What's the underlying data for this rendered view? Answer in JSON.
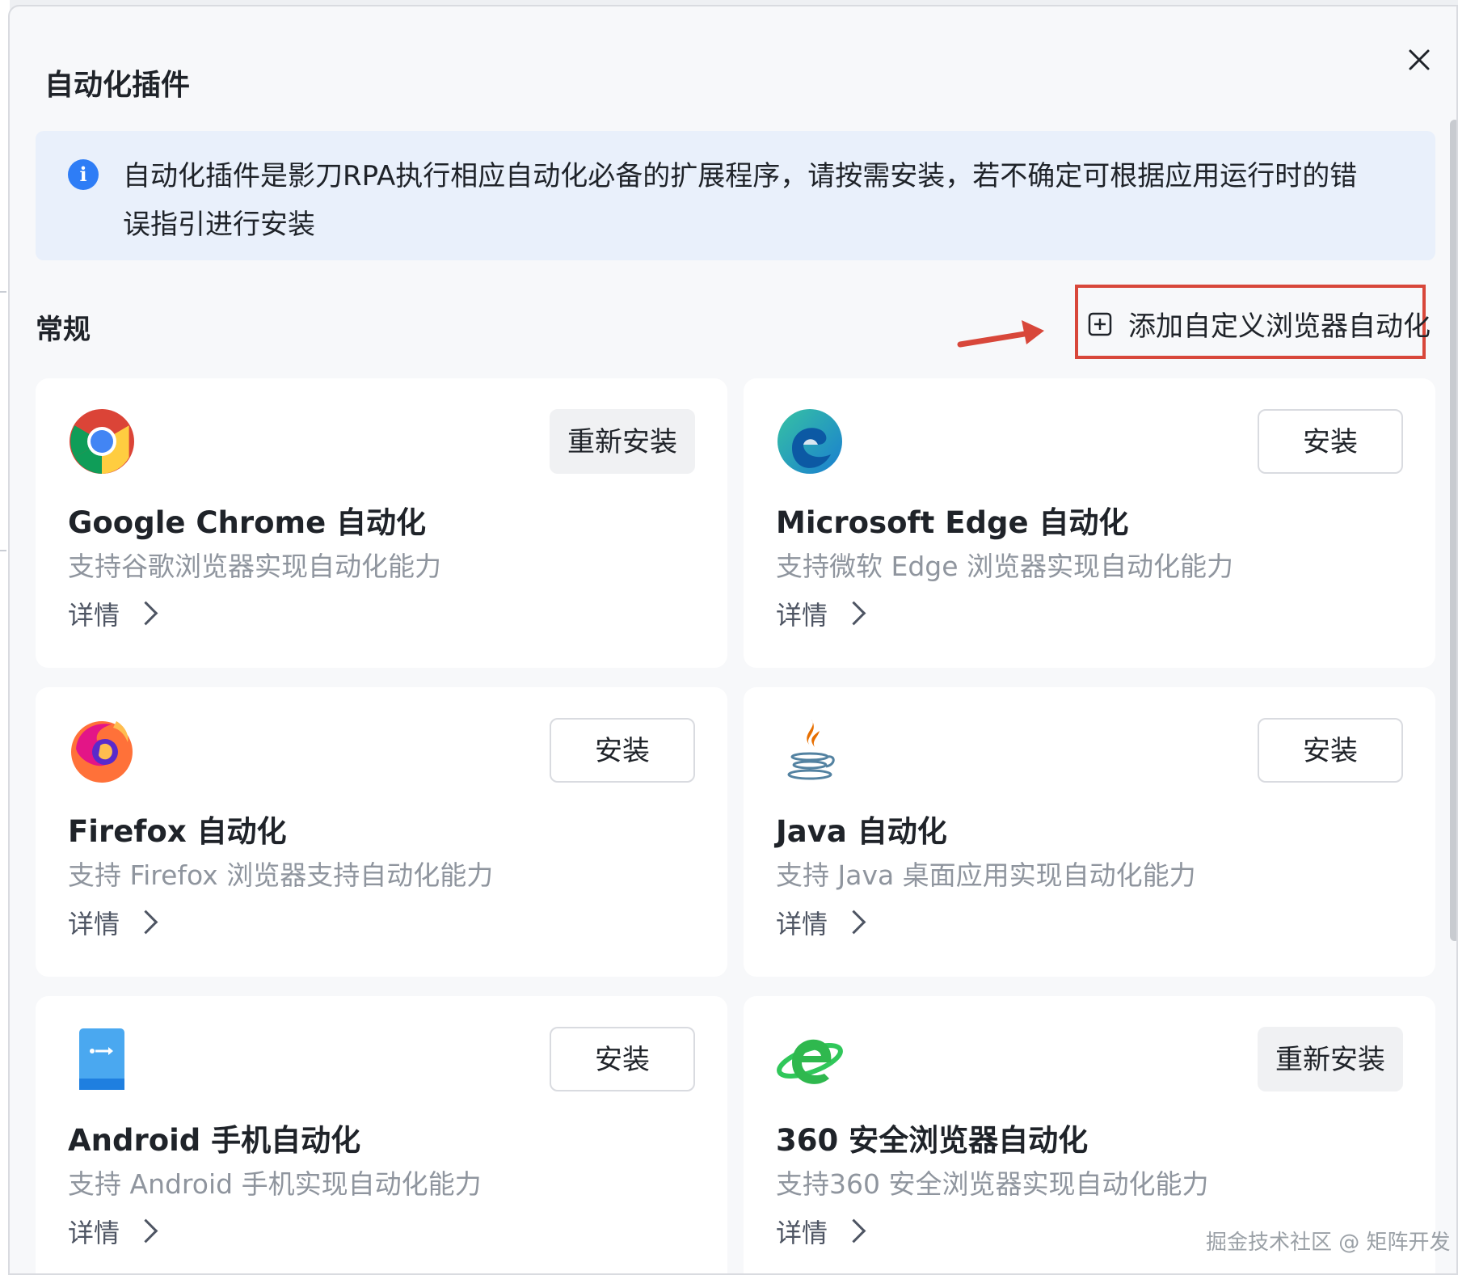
{
  "dialog": {
    "title": "自动化插件",
    "close_icon": "close-icon"
  },
  "notice": {
    "icon": "info-icon",
    "icon_glyph": "i",
    "text": "自动化插件是影刀RPA执行相应自动化必备的扩展程序，请按需安装，若不确定可根据应用运行时的错误指引进行安装"
  },
  "section": {
    "title": "常规",
    "add_button_label": "添加自定义浏览器自动化"
  },
  "plugins": [
    {
      "name": "Google Chrome 自动化",
      "desc": "支持谷歌浏览器实现自动化能力",
      "action": "重新安装",
      "details": "详情",
      "icon": "chrome-icon"
    },
    {
      "name": "Microsoft Edge 自动化",
      "desc": "支持微软 Edge 浏览器实现自动化能力",
      "action": "安装",
      "details": "详情",
      "icon": "edge-icon"
    },
    {
      "name": "Firefox 自动化",
      "desc": "支持 Firefox 浏览器支持自动化能力",
      "action": "安装",
      "details": "详情",
      "icon": "firefox-icon"
    },
    {
      "name": "Java 自动化",
      "desc": "支持 Java 桌面应用实现自动化能力",
      "action": "安装",
      "details": "详情",
      "icon": "java-icon"
    },
    {
      "name": "Android 手机自动化",
      "desc": "支持 Android 手机实现自动化能力",
      "action": "安装",
      "details": "详情",
      "icon": "android-phone-icon"
    },
    {
      "name": "360 安全浏览器自动化",
      "desc": "支持360 安全浏览器实现自动化能力",
      "action": "重新安装",
      "details": "详情",
      "icon": "360-browser-icon"
    }
  ],
  "watermark": "掘金技术社区 @ 矩阵开发",
  "colors": {
    "accent_blue": "#2e7df6",
    "highlight_red": "#d8473a",
    "notice_bg": "#e9f0fb"
  }
}
